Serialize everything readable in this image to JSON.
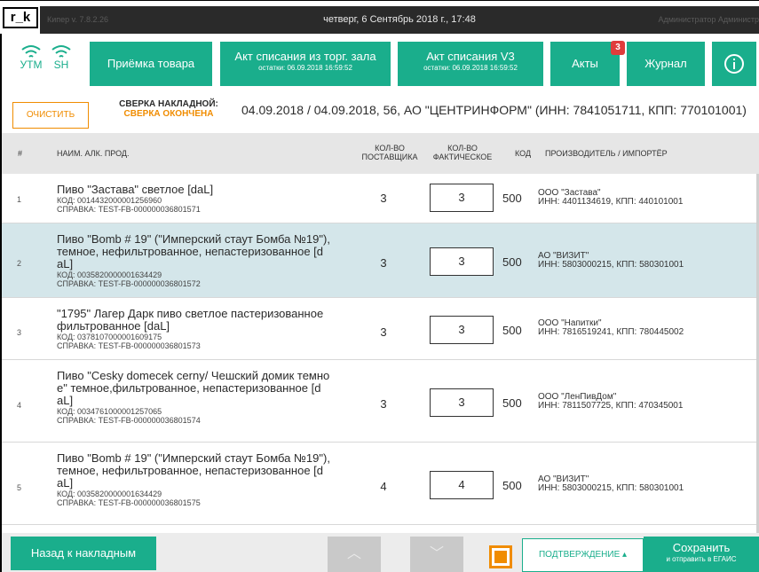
{
  "app": {
    "logo": "r_k",
    "version": "Кипер v. 7.8.2.26",
    "datetime": "четверг, 6 Сентябрь 2018 г., 17:48",
    "user": "Администратор Администр"
  },
  "nav": {
    "utm_label": "УТМ",
    "sh_label": "SH",
    "priemka": "Приёмка товара",
    "act_trade": {
      "label": "Акт списания из торг. зала",
      "sub": "остатки: 06.09.2018 16:59:52"
    },
    "act_v3": {
      "label": "Акт списания V3",
      "sub": "остатки: 06.09.2018 16:59:52"
    },
    "acts": {
      "label": "Акты",
      "badge": "3"
    },
    "journal": "Журнал",
    "info": "i"
  },
  "recon": {
    "clear": "ОЧИСТИТЬ",
    "title": "СВЕРКА НАКЛАДНОЙ:",
    "status": "СВЕРКА ОКОНЧЕНА",
    "info": "04.09.2018 / 04.09.2018, 56, АО \"ЦЕНТРИНФОРМ\" (ИНН: 7841051711, КПП: 770101001)"
  },
  "table": {
    "headers": {
      "num": "#",
      "name": "НАИМ. АЛК. ПРОД.",
      "qty_supplier_1": "КОЛ-ВО",
      "qty_supplier_2": "ПОСТАВЩИКА",
      "qty_actual_1": "КОЛ-ВО",
      "qty_actual_2": "ФАКТИЧЕСКОЕ",
      "code": "КОД",
      "producer": "ПРОИЗВОДИТЕЛЬ / ИМПОРТЁР"
    },
    "rows": [
      {
        "num": "1",
        "name_lines": [
          "Пиво \"Застава\" светлое  [daL]"
        ],
        "kod": "КОД: 0014432000001256960",
        "spravka": "СПРАВКА: TEST-FB-000000036801571",
        "qty_supplier": "3",
        "qty_actual": "3",
        "code": "500",
        "producer": "ООО \"Застава\"",
        "producer_ids": "ИНН: 4401134619, КПП: 440101001"
      },
      {
        "num": "2",
        "name_lines": [
          "Пиво \"Bomb # 19\" (\"Имперский стаут Бомба №19\"),",
          "темное, нефильтрованное, непастеризованное  [d",
          "aL]"
        ],
        "kod": "КОД: 0035820000001634429",
        "spravka": "СПРАВКА: TEST-FB-000000036801572",
        "qty_supplier": "3",
        "qty_actual": "3",
        "code": "500",
        "producer": "АО \"ВИЗИТ\"",
        "producer_ids": "ИНН: 5803000215, КПП: 580301001"
      },
      {
        "num": "3",
        "name_lines": [
          "\"1795\" Лагер Дарк пиво светлое пастеризованное",
          "фильтрованное  [daL]"
        ],
        "kod": "КОД: 0378107000001609175",
        "spravka": "СПРАВКА: TEST-FB-000000036801573",
        "qty_supplier": "3",
        "qty_actual": "3",
        "code": "500",
        "producer": "ООО \"Напитки\"",
        "producer_ids": "ИНН: 7816519241, КПП: 780445002"
      },
      {
        "num": "4",
        "name_lines": [
          "Пиво \"Cesky domecek cerny/ Чешский домик темно",
          "е\" темное,фильтрованное, непастеризованное  [d",
          "aL]"
        ],
        "kod": "КОД: 0034761000001257065",
        "spravka": "СПРАВКА: TEST-FB-000000036801574",
        "qty_supplier": "3",
        "qty_actual": "3",
        "code": "500",
        "producer": "ООО \"ЛенПивДом\"",
        "producer_ids": "ИНН: 7811507725, КПП: 470345001"
      },
      {
        "num": "5",
        "name_lines": [
          "Пиво \"Bomb # 19\" (\"Имперский стаут Бомба №19\"),",
          "темное, нефильтрованное, непастеризованное  [d",
          "aL]"
        ],
        "kod": "КОД: 0035820000001634429",
        "spravka": "СПРАВКА: TEST-FB-000000036801575",
        "qty_supplier": "4",
        "qty_actual": "4",
        "code": "500",
        "producer": "АО \"ВИЗИТ\"",
        "producer_ids": "ИНН: 5803000215, КПП: 580301001"
      }
    ]
  },
  "bottom": {
    "back": "Назад к накладным",
    "up": "︿",
    "down": "﹀",
    "confirm": "ПОДТВЕРЖДЕНИЕ ▴",
    "save_main": "Сохранить",
    "save_sub": "и отправить в ЕГАИС"
  },
  "colors": {
    "accent": "#1aae8c",
    "orange": "#f08c00",
    "badge": "#e03c3c",
    "selected_row": "#d4e6ea"
  }
}
